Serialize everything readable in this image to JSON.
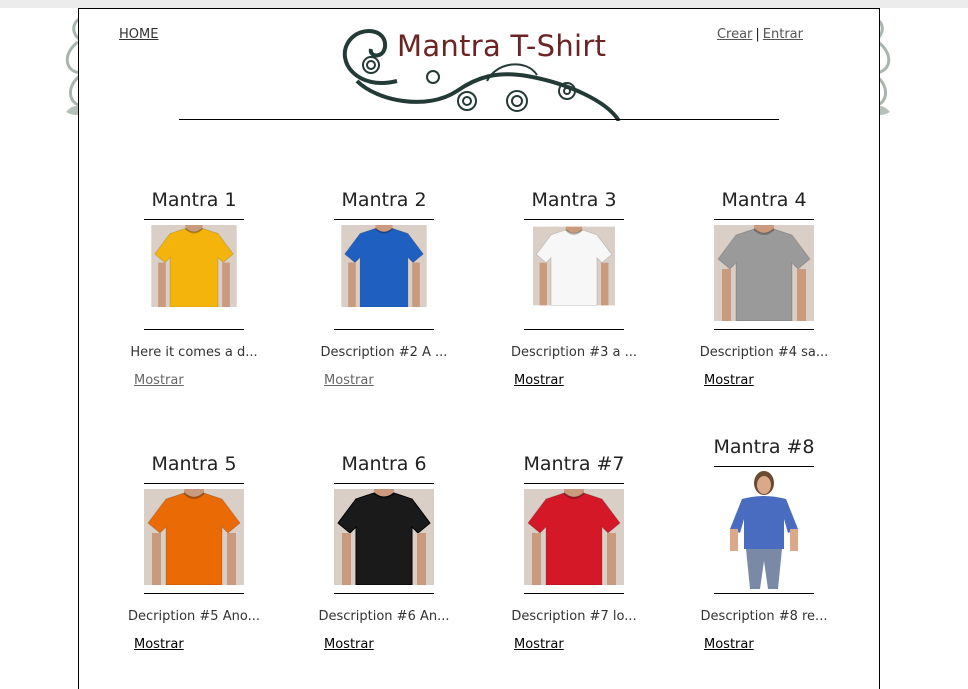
{
  "header": {
    "home_label": "HOME",
    "logo_text": "Mantra T-Shirt",
    "create_label": "Crear",
    "separator": "|",
    "login_label": "Entrar"
  },
  "products": [
    {
      "title": "Mantra 1",
      "desc": "Here it comes a d...",
      "show_label": "Mostrar",
      "shirt_color": "#f5b40b",
      "visited": true,
      "model": "tee"
    },
    {
      "title": "Mantra 2",
      "desc": "Description #2 A ...",
      "show_label": "Mostrar",
      "shirt_color": "#1f5fc0",
      "visited": true,
      "model": "tee"
    },
    {
      "title": "Mantra 3",
      "desc": "Description #3 a ...",
      "show_label": "Mostrar",
      "shirt_color": "#f7f7f7",
      "visited": false,
      "model": "tee"
    },
    {
      "title": "Mantra 4",
      "desc": "Description #4 sa...",
      "show_label": "Mostrar",
      "shirt_color": "#9a9a9a",
      "visited": false,
      "model": "tee"
    },
    {
      "title": "Mantra 5",
      "desc": "Decription #5 Ano...",
      "show_label": "Mostrar",
      "shirt_color": "#ea6a06",
      "visited": false,
      "model": "tee"
    },
    {
      "title": "Mantra 6",
      "desc": "Description #6 An...",
      "show_label": "Mostrar",
      "shirt_color": "#1a1a1a",
      "visited": false,
      "model": "tee"
    },
    {
      "title": "Mantra #7",
      "desc": "Description #7 lo...",
      "show_label": "Mostrar",
      "shirt_color": "#d41828",
      "visited": false,
      "model": "tee"
    },
    {
      "title": "Mantra #8",
      "desc": "Description #8 re...",
      "show_label": "Mostrar",
      "shirt_color": "#4a6cc0",
      "visited": false,
      "model": "woman"
    }
  ],
  "colors": {
    "logo_text": "#6b2323",
    "link_visited": "#666666",
    "link": "#000000"
  }
}
